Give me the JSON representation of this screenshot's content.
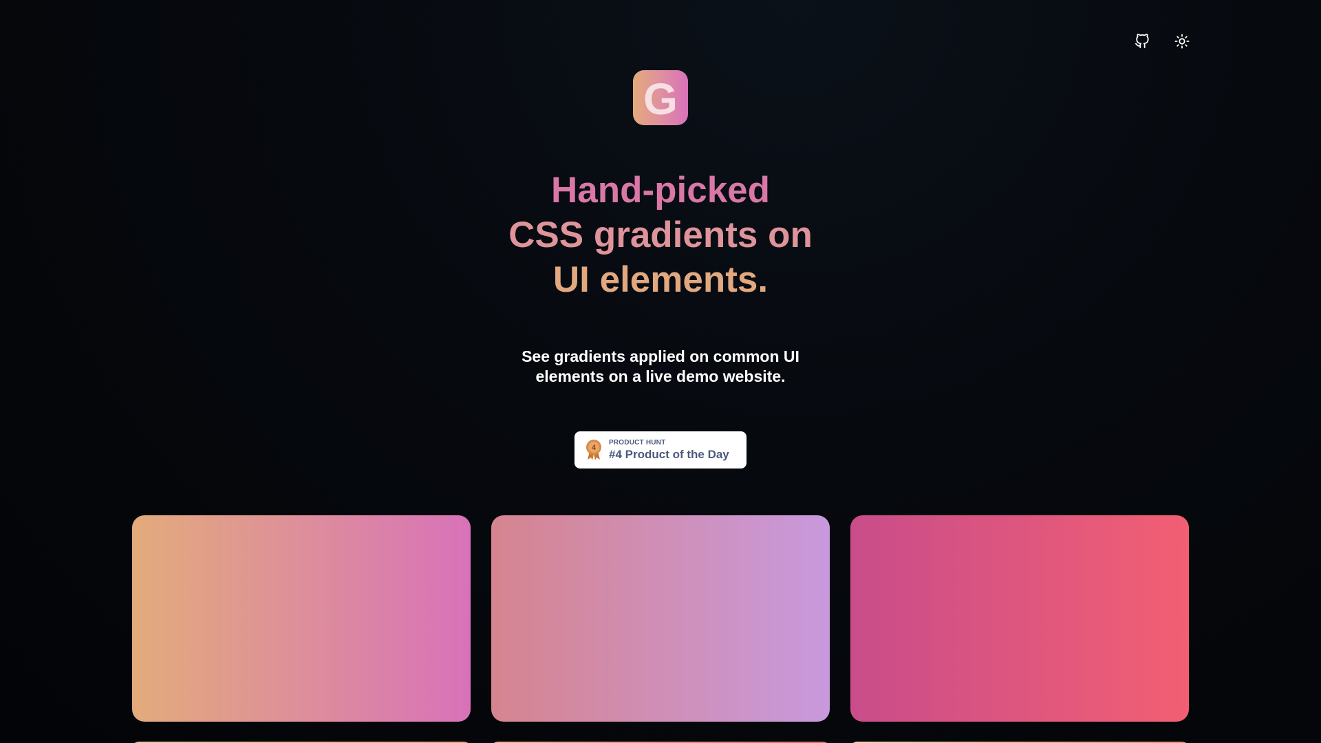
{
  "header": {
    "github_icon": "github-icon",
    "theme_icon": "sun-icon"
  },
  "logo": {
    "letter": "G",
    "colors": [
      "#e3ab7b",
      "#df8da3",
      "#d872b9"
    ]
  },
  "hero": {
    "title_lines": [
      "Hand-picked",
      "CSS gradients on",
      "UI elements."
    ],
    "subtitle_lines": [
      "See gradients applied on common UI",
      "elements on a live demo website."
    ]
  },
  "badge": {
    "kicker": "PRODUCT HUNT",
    "text": "#4 Product of the Day",
    "medal_number": "4",
    "icon": "medal-icon"
  },
  "gradients": [
    {
      "from": "#e3ab7b",
      "to": "#d872b9"
    },
    {
      "from": "#d6848f",
      "to": "#c899dd"
    },
    {
      "from": "#c94d8a",
      "to": "#f25f73"
    }
  ],
  "gradients_next_row": [
    {
      "from": "#e8c79a",
      "to": "#f0a07a"
    },
    {
      "from": "#f1b28a",
      "to": "#e46a6a"
    },
    {
      "from": "#f2d3a2",
      "to": "#e78e70"
    }
  ]
}
